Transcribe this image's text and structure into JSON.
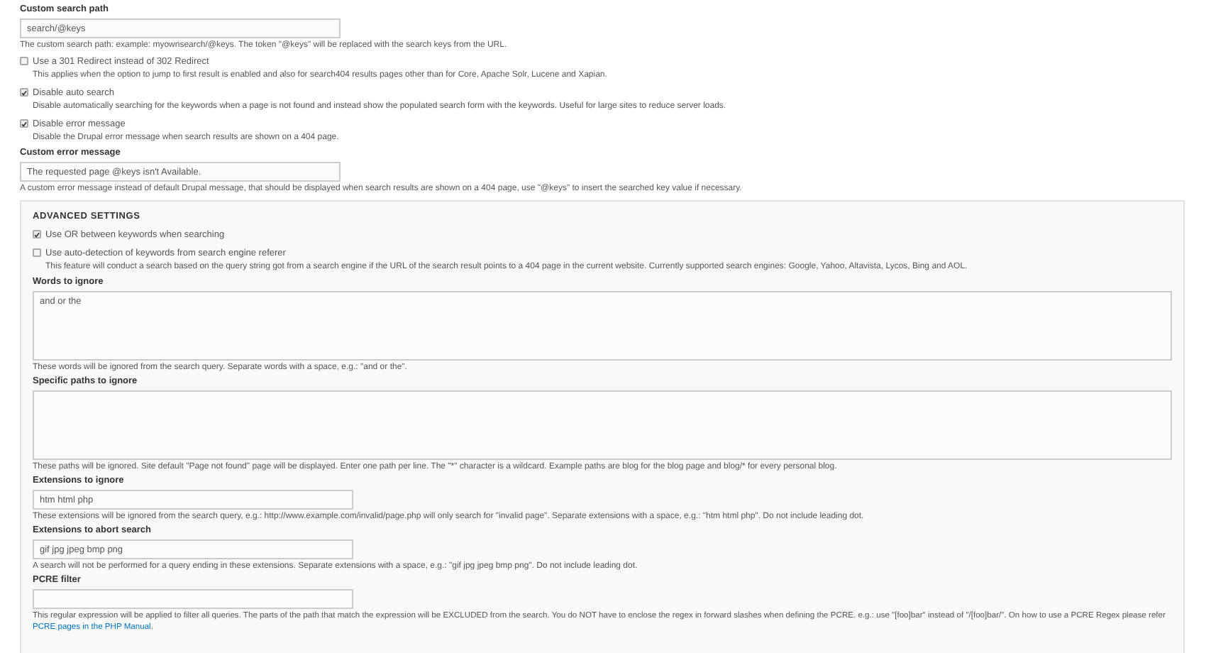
{
  "items": [
    {
      "kind": "text_field",
      "label": "Custom search path",
      "value": "search/@keys",
      "description": "The custom search path: example: myownsearch/@keys. The token \"@keys\" will be replaced with the search keys from the URL."
    },
    {
      "kind": "checkbox",
      "label": "Use a 301 Redirect instead of 302 Redirect",
      "checked": false,
      "description": "This applies when the option to jump to first result is enabled and also for search404 results pages other than for Core, Apache Solr, Lucene and Xapian."
    },
    {
      "kind": "checkbox",
      "label": "Disable auto search",
      "checked": true,
      "description": "Disable automatically searching for the keywords when a page is not found and instead show the populated search form with the keywords. Useful for large sites to reduce server loads."
    },
    {
      "kind": "checkbox",
      "label": "Disable error message",
      "checked": true,
      "description": "Disable the Drupal error message when search results are shown on a 404 page."
    },
    {
      "kind": "text_field",
      "label": "Custom error message",
      "value": "The requested page @keys isn't Available.",
      "description": "A custom error message instead of default Drupal message, that should be displayed when search results are shown on a 404 page, use \"@keys\" to insert the searched key value if necessary."
    },
    {
      "kind": "fieldset",
      "legend": "ADVANCED SETTINGS",
      "items": [
        {
          "kind": "checkbox",
          "label": "Use OR between keywords when searching",
          "checked": true
        },
        {
          "kind": "checkbox",
          "label": "Use auto-detection of keywords from search engine referer",
          "checked": false,
          "description": "This feature will conduct a search based on the query string got from a search engine if the URL of the search result points to a 404 page in the current website. Currently supported search engines: Google, Yahoo, Altavista, Lycos, Bing and AOL."
        },
        {
          "kind": "textarea",
          "label": "Words to ignore",
          "value": "and or the",
          "description": "These words will be ignored from the search query. Separate words with a space, e.g.: \"and or the\"."
        },
        {
          "kind": "textarea",
          "label": "Specific paths to ignore",
          "description": "These paths will be ignored. Site default \"Page not found\" page will be displayed. Enter one path per line. The \"*\" character is a wildcard. Example paths are blog for the blog page and blog/* for every personal blog."
        },
        {
          "kind": "text_field",
          "label": "Extensions to ignore",
          "value": "htm html php",
          "description": "These extensions will be ignored from the search query, e.g.: http://www.example.com/invalid/page.php will only search for \"invalid page\". Separate extensions with a space, e.g.: \"htm html php\". Do not include leading dot."
        },
        {
          "kind": "text_field",
          "label": "Extensions to abort search",
          "value": "gif jpg jpeg bmp png",
          "description": "A search will not be performed for a query ending in these extensions. Separate extensions with a space, e.g.: \"gif jpg jpeg bmp png\". Do not include leading dot."
        },
        {
          "kind": "text_field",
          "label": "PCRE filter",
          "description": "This regular expression will be applied to filter all queries. The parts of the path that match the expression will be EXCLUDED from the search. You do NOT have to enclose the regex in forward slashes when defining the PCRE. e.g.: use \"[foo]bar\" instead of \"/[foo]bar/\". On how to use a PCRE Regex please refer",
          "link": "PCRE pages in the PHP Manual",
          "after": "."
        }
      ]
    }
  ]
}
